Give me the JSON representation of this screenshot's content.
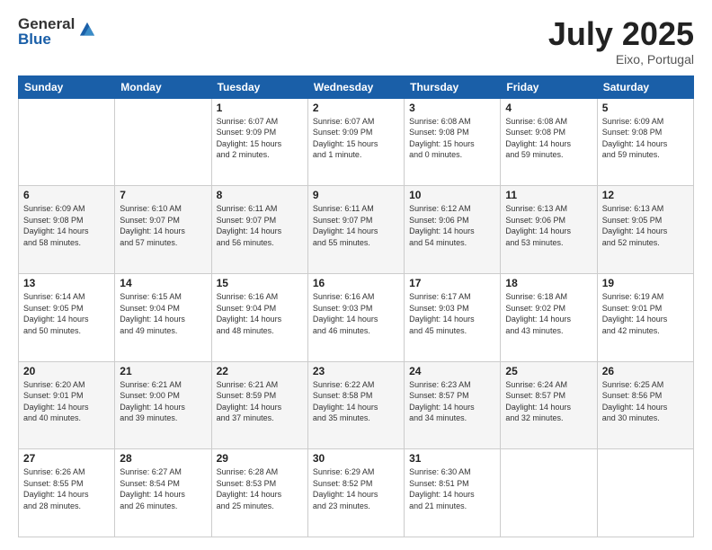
{
  "header": {
    "logo_general": "General",
    "logo_blue": "Blue",
    "month_title": "July 2025",
    "location": "Eixo, Portugal"
  },
  "days_of_week": [
    "Sunday",
    "Monday",
    "Tuesday",
    "Wednesday",
    "Thursday",
    "Friday",
    "Saturday"
  ],
  "weeks": [
    [
      {
        "day": "",
        "info": ""
      },
      {
        "day": "",
        "info": ""
      },
      {
        "day": "1",
        "info": "Sunrise: 6:07 AM\nSunset: 9:09 PM\nDaylight: 15 hours\nand 2 minutes."
      },
      {
        "day": "2",
        "info": "Sunrise: 6:07 AM\nSunset: 9:09 PM\nDaylight: 15 hours\nand 1 minute."
      },
      {
        "day": "3",
        "info": "Sunrise: 6:08 AM\nSunset: 9:08 PM\nDaylight: 15 hours\nand 0 minutes."
      },
      {
        "day": "4",
        "info": "Sunrise: 6:08 AM\nSunset: 9:08 PM\nDaylight: 14 hours\nand 59 minutes."
      },
      {
        "day": "5",
        "info": "Sunrise: 6:09 AM\nSunset: 9:08 PM\nDaylight: 14 hours\nand 59 minutes."
      }
    ],
    [
      {
        "day": "6",
        "info": "Sunrise: 6:09 AM\nSunset: 9:08 PM\nDaylight: 14 hours\nand 58 minutes."
      },
      {
        "day": "7",
        "info": "Sunrise: 6:10 AM\nSunset: 9:07 PM\nDaylight: 14 hours\nand 57 minutes."
      },
      {
        "day": "8",
        "info": "Sunrise: 6:11 AM\nSunset: 9:07 PM\nDaylight: 14 hours\nand 56 minutes."
      },
      {
        "day": "9",
        "info": "Sunrise: 6:11 AM\nSunset: 9:07 PM\nDaylight: 14 hours\nand 55 minutes."
      },
      {
        "day": "10",
        "info": "Sunrise: 6:12 AM\nSunset: 9:06 PM\nDaylight: 14 hours\nand 54 minutes."
      },
      {
        "day": "11",
        "info": "Sunrise: 6:13 AM\nSunset: 9:06 PM\nDaylight: 14 hours\nand 53 minutes."
      },
      {
        "day": "12",
        "info": "Sunrise: 6:13 AM\nSunset: 9:05 PM\nDaylight: 14 hours\nand 52 minutes."
      }
    ],
    [
      {
        "day": "13",
        "info": "Sunrise: 6:14 AM\nSunset: 9:05 PM\nDaylight: 14 hours\nand 50 minutes."
      },
      {
        "day": "14",
        "info": "Sunrise: 6:15 AM\nSunset: 9:04 PM\nDaylight: 14 hours\nand 49 minutes."
      },
      {
        "day": "15",
        "info": "Sunrise: 6:16 AM\nSunset: 9:04 PM\nDaylight: 14 hours\nand 48 minutes."
      },
      {
        "day": "16",
        "info": "Sunrise: 6:16 AM\nSunset: 9:03 PM\nDaylight: 14 hours\nand 46 minutes."
      },
      {
        "day": "17",
        "info": "Sunrise: 6:17 AM\nSunset: 9:03 PM\nDaylight: 14 hours\nand 45 minutes."
      },
      {
        "day": "18",
        "info": "Sunrise: 6:18 AM\nSunset: 9:02 PM\nDaylight: 14 hours\nand 43 minutes."
      },
      {
        "day": "19",
        "info": "Sunrise: 6:19 AM\nSunset: 9:01 PM\nDaylight: 14 hours\nand 42 minutes."
      }
    ],
    [
      {
        "day": "20",
        "info": "Sunrise: 6:20 AM\nSunset: 9:01 PM\nDaylight: 14 hours\nand 40 minutes."
      },
      {
        "day": "21",
        "info": "Sunrise: 6:21 AM\nSunset: 9:00 PM\nDaylight: 14 hours\nand 39 minutes."
      },
      {
        "day": "22",
        "info": "Sunrise: 6:21 AM\nSunset: 8:59 PM\nDaylight: 14 hours\nand 37 minutes."
      },
      {
        "day": "23",
        "info": "Sunrise: 6:22 AM\nSunset: 8:58 PM\nDaylight: 14 hours\nand 35 minutes."
      },
      {
        "day": "24",
        "info": "Sunrise: 6:23 AM\nSunset: 8:57 PM\nDaylight: 14 hours\nand 34 minutes."
      },
      {
        "day": "25",
        "info": "Sunrise: 6:24 AM\nSunset: 8:57 PM\nDaylight: 14 hours\nand 32 minutes."
      },
      {
        "day": "26",
        "info": "Sunrise: 6:25 AM\nSunset: 8:56 PM\nDaylight: 14 hours\nand 30 minutes."
      }
    ],
    [
      {
        "day": "27",
        "info": "Sunrise: 6:26 AM\nSunset: 8:55 PM\nDaylight: 14 hours\nand 28 minutes."
      },
      {
        "day": "28",
        "info": "Sunrise: 6:27 AM\nSunset: 8:54 PM\nDaylight: 14 hours\nand 26 minutes."
      },
      {
        "day": "29",
        "info": "Sunrise: 6:28 AM\nSunset: 8:53 PM\nDaylight: 14 hours\nand 25 minutes."
      },
      {
        "day": "30",
        "info": "Sunrise: 6:29 AM\nSunset: 8:52 PM\nDaylight: 14 hours\nand 23 minutes."
      },
      {
        "day": "31",
        "info": "Sunrise: 6:30 AM\nSunset: 8:51 PM\nDaylight: 14 hours\nand 21 minutes."
      },
      {
        "day": "",
        "info": ""
      },
      {
        "day": "",
        "info": ""
      }
    ]
  ]
}
